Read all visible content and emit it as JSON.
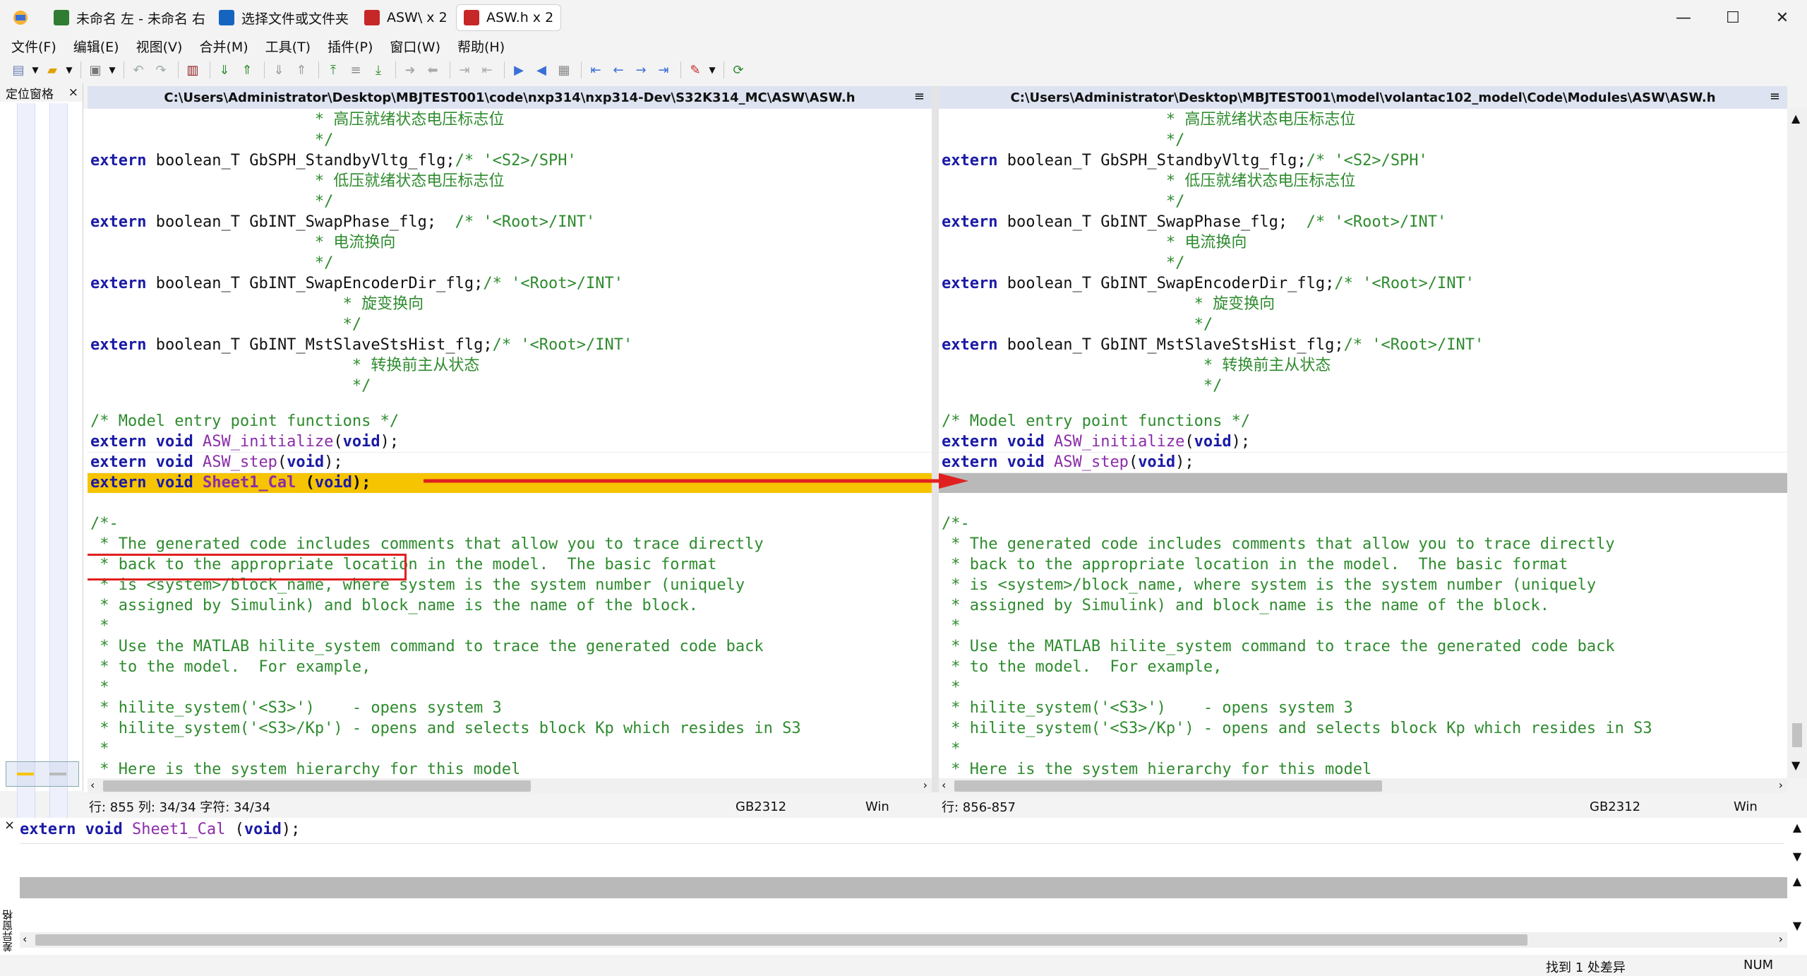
{
  "tabs": [
    {
      "label": "未命名 左 - 未命名 右",
      "icon": "cn-document-icon",
      "color": "#2e7d32"
    },
    {
      "label": "选择文件或文件夹",
      "icon": "folder-select-icon",
      "color": "#1565c0"
    },
    {
      "label": "ASW\\ x 2",
      "icon": "file-diff-icon",
      "color": "#c62828"
    },
    {
      "label": "ASW.h x 2",
      "icon": "file-diff-icon",
      "color": "#c62828"
    }
  ],
  "window": {
    "minimize": "—",
    "maximize": "☐",
    "close": "✕"
  },
  "menu": [
    "文件(F)",
    "编辑(E)",
    "视图(V)",
    "合并(M)",
    "工具(T)",
    "插件(P)",
    "窗口(W)",
    "帮助(H)"
  ],
  "location_pane": {
    "title": "定位窗格",
    "close": "×"
  },
  "left": {
    "path": "C:\\Users\\Administrator\\Desktop\\MBJTEST001\\code\\nxp314\\nxp314-Dev\\S32K314_MC\\ASW\\ASW.h",
    "lines": [
      "                        * 高压就绪状态电压标志位",
      "                        */",
      "extern boolean_T GbSPH_StandbyVltg_flg;/* '<S2>/SPH'",
      "                        * 低压就绪状态电压标志位",
      "                        */",
      "extern boolean_T GbINT_SwapPhase_flg;  /* '<Root>/INT'",
      "                        * 电流换向",
      "                        */",
      "extern boolean_T GbINT_SwapEncoderDir_flg;/* '<Root>/INT'",
      "                           * 旋变换向",
      "                           */",
      "extern boolean_T GbINT_MstSlaveStsHist_flg;/* '<Root>/INT'",
      "                            * 转换前主从状态",
      "                            */",
      "",
      "/* Model entry point functions */",
      "extern void ASW_initialize(void);",
      "extern void ASW_step(void);",
      "extern void Sheet1_Cal (void);",
      "",
      "/*-",
      " * The generated code includes comments that allow you to trace directly",
      " * back to the appropriate location in the model.  The basic format",
      " * is <system>/block_name, where system is the system number (uniquely",
      " * assigned by Simulink) and block_name is the name of the block.",
      " *",
      " * Use the MATLAB hilite_system command to trace the generated code back",
      " * to the model.  For example,",
      " *",
      " * hilite_system('<S3>')    - opens system 3",
      " * hilite_system('<S3>/Kp') - opens and selects block Kp which resides in S3",
      " *",
      " * Here is the system hierarchy for this model"
    ],
    "status": {
      "position": "行: 855  列: 34/34  字符: 34/34",
      "encoding": "GB2312",
      "eol": "Win"
    }
  },
  "right": {
    "path": "C:\\Users\\Administrator\\Desktop\\MBJTEST001\\model\\volantac102_model\\Code\\Modules\\ASW\\ASW.h",
    "lines": [
      "                        * 高压就绪状态电压标志位",
      "                        */",
      "extern boolean_T GbSPH_StandbyVltg_flg;/* '<S2>/SPH'",
      "                        * 低压就绪状态电压标志位",
      "                        */",
      "extern boolean_T GbINT_SwapPhase_flg;  /* '<Root>/INT'",
      "                        * 电流换向",
      "                        */",
      "extern boolean_T GbINT_SwapEncoderDir_flg;/* '<Root>/INT'",
      "                           * 旋变换向",
      "                           */",
      "extern boolean_T GbINT_MstSlaveStsHist_flg;/* '<Root>/INT'",
      "                            * 转换前主从状态",
      "                            */",
      "",
      "/* Model entry point functions */",
      "extern void ASW_initialize(void);",
      "extern void ASW_step(void);",
      "",
      "",
      "/*-",
      " * The generated code includes comments that allow you to trace directly",
      " * back to the appropriate location in the model.  The basic format",
      " * is <system>/block_name, where system is the system number (uniquely",
      " * assigned by Simulink) and block_name is the name of the block.",
      " *",
      " * Use the MATLAB hilite_system command to trace the generated code back",
      " * to the model.  For example,",
      " *",
      " * hilite_system('<S3>')    - opens system 3",
      " * hilite_system('<S3>/Kp') - opens and selects block Kp which resides in S3",
      " *",
      " * Here is the system hierarchy for this model"
    ],
    "status": {
      "position": "行: 856-857",
      "encoding": "GB2312",
      "eol": "Win"
    }
  },
  "diff_detail": {
    "left_line": "extern void Sheet1_Cal (void);",
    "right_line": "",
    "label": "差异窗格"
  },
  "statusbar": {
    "diff_count": "找到 1 处差异",
    "num": "NUM"
  },
  "colors": {
    "keyword": "#1a1aa6",
    "comment": "#2e8b2e",
    "function": "#8b2da8",
    "diff_yellow": "#f6c400",
    "diff_gray": "#b9b9b9",
    "callout": "#e02020"
  }
}
